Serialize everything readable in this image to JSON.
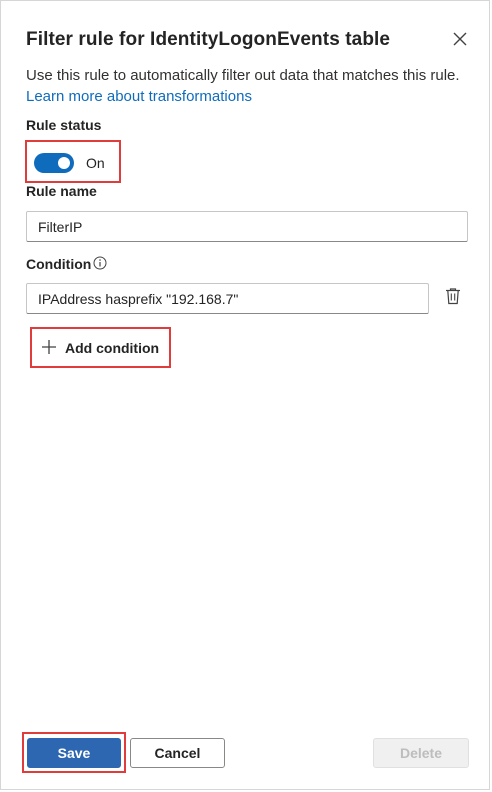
{
  "panel": {
    "title": "Filter rule for IdentityLogonEvents table",
    "description_text": "Use this rule to automatically filter out data that matches this rule.",
    "description_link": "Learn more about transformations"
  },
  "rule_status": {
    "label": "Rule status",
    "toggle_state": "On"
  },
  "rule_name": {
    "label": "Rule name",
    "value": "FilterIP"
  },
  "condition": {
    "label": "Condition",
    "value": "IPAddress hasprefix \"192.168.7\"",
    "add_label": "Add condition"
  },
  "footer": {
    "save_label": "Save",
    "cancel_label": "Cancel",
    "delete_label": "Delete"
  },
  "colors": {
    "accent": "#0f6cbd",
    "save_button": "#2e67b1",
    "highlight": "#e03c3c"
  },
  "icons": [
    "close-icon",
    "info-icon",
    "trash-icon",
    "plus-icon"
  ]
}
